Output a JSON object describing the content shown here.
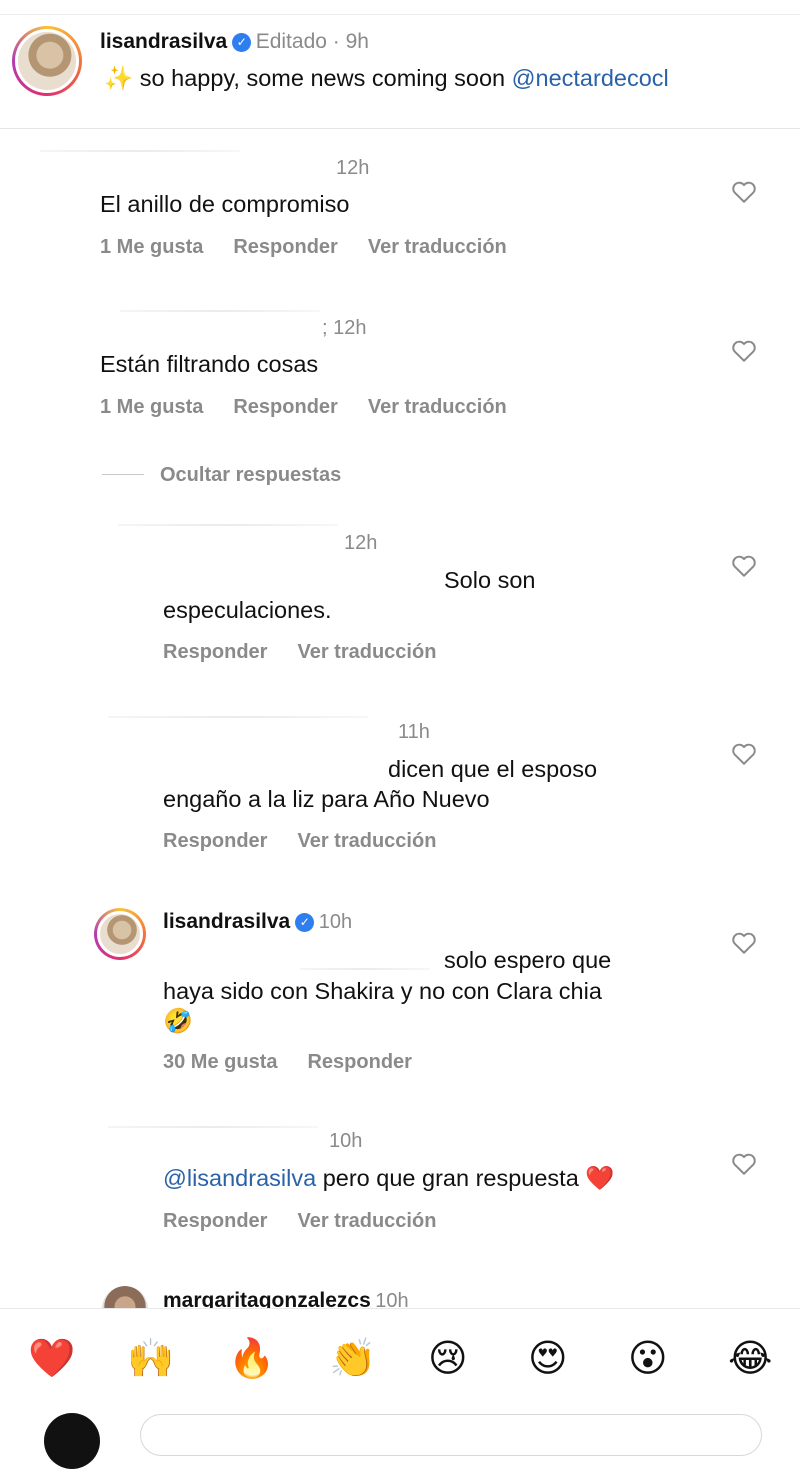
{
  "post": {
    "username": "lisandrasilva",
    "meta": "Editado · 9h",
    "caption_emoji": "✨",
    "caption_text": " so happy, some news coming soon ",
    "caption_mention": "@nectardecocl"
  },
  "comments": [
    {
      "time": "12h",
      "text": "El anillo de compromiso",
      "likes": "1 Me gusta",
      "reply": "Responder",
      "translate": "Ver traducción"
    },
    {
      "time": "; 12h",
      "text": "Están filtrando cosas",
      "likes": "1 Me gusta",
      "reply": "Responder",
      "translate": "Ver traducción"
    }
  ],
  "hide_replies": "Ocultar respuestas",
  "replies": [
    {
      "time": "12h",
      "text_line1": "Solo son",
      "text_line2": "especulaciones.",
      "reply": "Responder",
      "translate": "Ver traducción"
    },
    {
      "time": "11h",
      "text_line1": "dicen que el esposo",
      "text_line2": "engaño a la liz para Año Nuevo",
      "reply": "Responder",
      "translate": "Ver traducción"
    },
    {
      "username": "lisandrasilva",
      "time": "10h",
      "text_line1": "solo espero que",
      "text_line2": "haya sido con Shakira y no con Clara chia",
      "emoji": "🤣",
      "likes": "30 Me gusta",
      "reply": "Responder"
    },
    {
      "time": "10h",
      "mention": "@lisandrasilva",
      "text": " pero que gran respuesta ",
      "emoji": "❤️",
      "reply": "Responder",
      "translate": "Ver traducción"
    },
    {
      "username": "margaritagonzalezcs",
      "time": "10h"
    }
  ],
  "reactions": [
    "❤️",
    "🙌",
    "🔥",
    "👏",
    "😢",
    "😍",
    "😮",
    "😂"
  ]
}
